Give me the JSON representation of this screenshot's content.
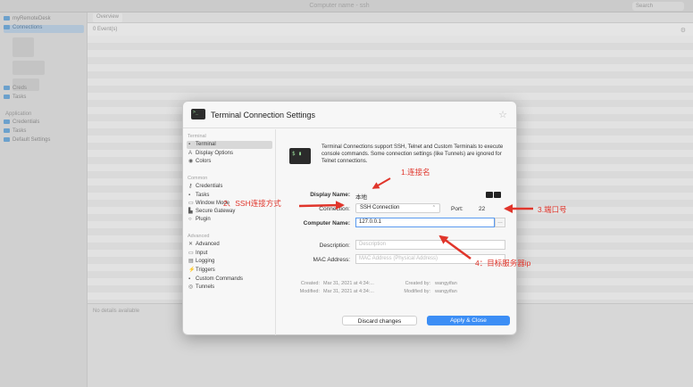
{
  "window": {
    "title": "Computer name - ssh",
    "search_placeholder": "Search"
  },
  "sidebar": {
    "root_label": "myRemoteDesk",
    "items": [
      {
        "label": "Connections"
      },
      {
        "label": "Creds"
      },
      {
        "label": "Tasks"
      }
    ],
    "app_header": "Application",
    "app_items": [
      {
        "label": "Credentials"
      },
      {
        "label": "Tasks"
      },
      {
        "label": "Default Settings"
      }
    ]
  },
  "main": {
    "tab": "Overview",
    "events_count": "0 Event(s)",
    "no_details": "No details available"
  },
  "dialog": {
    "title": "Terminal Connection Settings",
    "nav": {
      "terminal_header": "Terminal",
      "terminal_items": [
        "Terminal",
        "Display Options",
        "Colors"
      ],
      "common_header": "Common",
      "common_items": [
        "Credentials",
        "Tasks",
        "Window Mode",
        "Secure Gateway",
        "Plugin"
      ],
      "advanced_header": "Advanced",
      "advanced_items": [
        "Advanced",
        "Input",
        "Logging",
        "Triggers",
        "Custom Commands",
        "Tunnels"
      ]
    },
    "description": "Terminal Connections support SSH, Telnet and Custom Terminals to execute console commands. Some connection settings (like Tunnels) are ignored for Telnet connections.",
    "display_name_label": "Display Name:",
    "display_name_value": "本地",
    "connection_label": "Connection:",
    "connection_value": "SSH Connection",
    "port_label": "Port:",
    "port_value": "22",
    "computer_name_label": "Computer Name:",
    "computer_name_value": "127.0.0.1",
    "description_label": "Description:",
    "description_placeholder": "Description",
    "mac_label": "MAC Address:",
    "mac_placeholder": "MAC Address (Physical Address)",
    "created_label": "Created:",
    "created_value": "Mar 31, 2021 at 4:34:...",
    "created_by_label": "Created by:",
    "created_by_value": "wangyifan",
    "modified_label": "Modified:",
    "modified_value": "Mar 31, 2021 at 4:34:...",
    "modified_by_label": "Modified by:",
    "modified_by_value": "wangyifan",
    "discard_label": "Discard changes",
    "apply_label": "Apply & Close"
  },
  "annotations": {
    "a1": "1.连接名",
    "a2": "2、SSH连接方式",
    "a3": "3.端口号",
    "a4": "4：目标服务器ip"
  },
  "colors": {
    "accent": "#3c8ef5",
    "annotation": "#e0352b"
  }
}
